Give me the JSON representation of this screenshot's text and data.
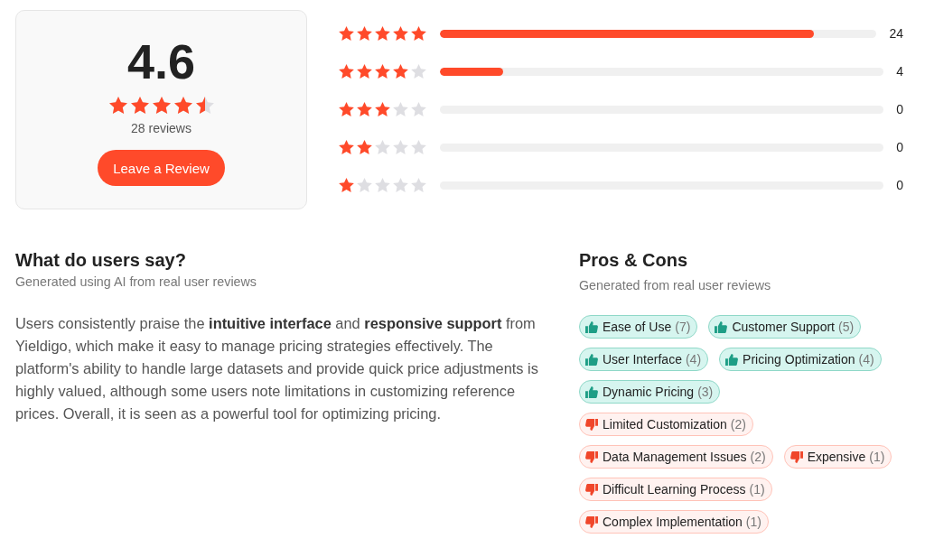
{
  "summary": {
    "rating": "4.6",
    "stars": 4.5,
    "reviews": "28 reviews",
    "button": "Leave a Review"
  },
  "distribution": [
    {
      "stars": 5,
      "level": 0.857,
      "count": "24"
    },
    {
      "stars": 4,
      "level": 0.143,
      "count": "4"
    },
    {
      "stars": 3,
      "count": "0"
    },
    {
      "stars": 2,
      "count": "0"
    },
    {
      "stars": 1,
      "count": "0"
    }
  ],
  "users_say": {
    "title": "What do users say?",
    "subtitle": "Generated using AI from real user reviews",
    "text": "Users consistently praise the **intuitive interface** and **responsive support** from Yieldigo, which make it easy to manage pricing strategies effectively. The platform's ability to handle large datasets and provide quick price adjustments is highly valued, although some users note limitations in customizing reference prices. Overall, it is seen as a powerful tool for optimizing pricing."
  },
  "pros_cons": {
    "title": "Pros & Cons",
    "subtitle": "Generated from real user reviews",
    "pros": [
      {
        "label": "Ease of Use",
        "count": "(7)"
      },
      {
        "label": "Customer Support",
        "count": "(5)"
      },
      {
        "label": "User Interface",
        "count": "(4)"
      },
      {
        "label": "Pricing Optimization",
        "count": "(4)"
      },
      {
        "label": "Dynamic Pricing",
        "count": "(3)"
      }
    ],
    "cons": [
      {
        "label": "Limited Customization",
        "count": "(2)"
      },
      {
        "label": "Data Management Issues",
        "count": "(2)"
      },
      {
        "label": "Expensive",
        "count": "(1)"
      },
      {
        "label": "Difficult Learning Process",
        "count": "(1)"
      },
      {
        "label": "Complex Implementation",
        "count": "(1)"
      }
    ]
  }
}
